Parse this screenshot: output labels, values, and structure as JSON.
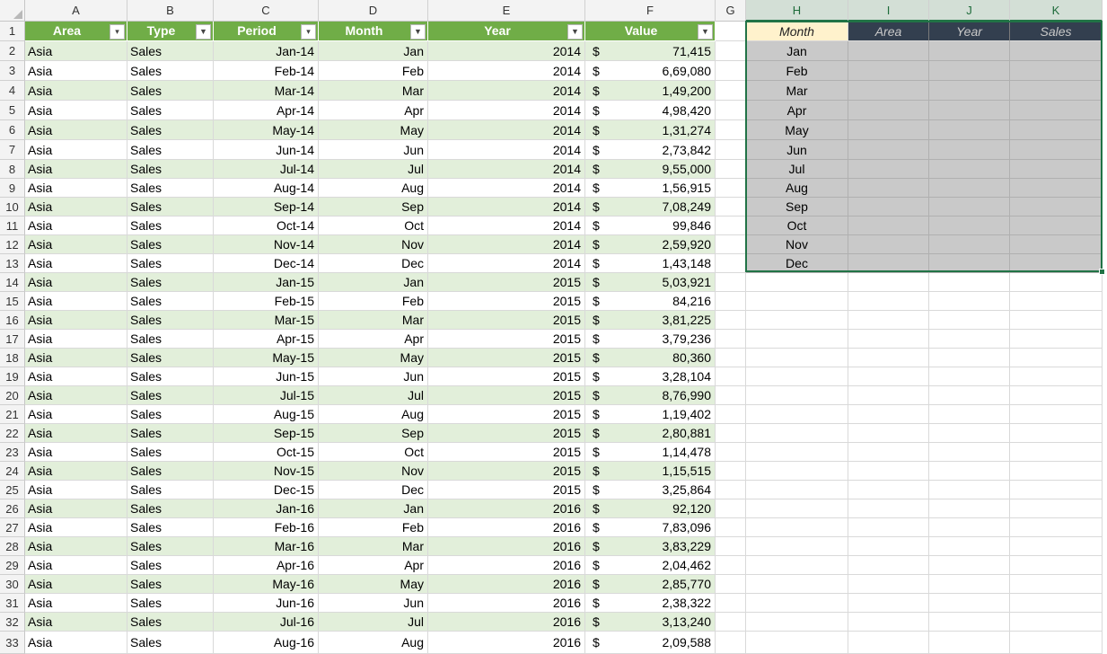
{
  "columns": [
    "A",
    "B",
    "C",
    "D",
    "E",
    "F",
    "G",
    "H",
    "I",
    "J",
    "K"
  ],
  "table_headers": {
    "A": "Area",
    "B": "Type",
    "C": "Period",
    "D": "Month",
    "E": "Year",
    "F": "Value"
  },
  "filter_icons": {
    "A": "sort-filter-icon",
    "B": "dropdown-icon",
    "C": "sort-filter-icon",
    "D": "dropdown-icon",
    "E": "dropdown-icon",
    "F": "dropdown-icon"
  },
  "summary_headers": {
    "H": "Month",
    "I": "Area",
    "J": "Year",
    "K": "Sales"
  },
  "currency_symbol": "$",
  "rows": [
    {
      "n": "2",
      "area": "Asia",
      "type": "Sales",
      "period": "Jan-14",
      "month": "Jan",
      "year": "2014",
      "value": "71,415"
    },
    {
      "n": "3",
      "area": "Asia",
      "type": "Sales",
      "period": "Feb-14",
      "month": "Feb",
      "year": "2014",
      "value": "6,69,080"
    },
    {
      "n": "4",
      "area": "Asia",
      "type": "Sales",
      "period": "Mar-14",
      "month": "Mar",
      "year": "2014",
      "value": "1,49,200"
    },
    {
      "n": "5",
      "area": "Asia",
      "type": "Sales",
      "period": "Apr-14",
      "month": "Apr",
      "year": "2014",
      "value": "4,98,420"
    },
    {
      "n": "6",
      "area": "Asia",
      "type": "Sales",
      "period": "May-14",
      "month": "May",
      "year": "2014",
      "value": "1,31,274"
    },
    {
      "n": "7",
      "area": "Asia",
      "type": "Sales",
      "period": "Jun-14",
      "month": "Jun",
      "year": "2014",
      "value": "2,73,842"
    },
    {
      "n": "8",
      "area": "Asia",
      "type": "Sales",
      "period": "Jul-14",
      "month": "Jul",
      "year": "2014",
      "value": "9,55,000"
    },
    {
      "n": "9",
      "area": "Asia",
      "type": "Sales",
      "period": "Aug-14",
      "month": "Aug",
      "year": "2014",
      "value": "1,56,915"
    },
    {
      "n": "10",
      "area": "Asia",
      "type": "Sales",
      "period": "Sep-14",
      "month": "Sep",
      "year": "2014",
      "value": "7,08,249"
    },
    {
      "n": "11",
      "area": "Asia",
      "type": "Sales",
      "period": "Oct-14",
      "month": "Oct",
      "year": "2014",
      "value": "99,846"
    },
    {
      "n": "12",
      "area": "Asia",
      "type": "Sales",
      "period": "Nov-14",
      "month": "Nov",
      "year": "2014",
      "value": "2,59,920"
    },
    {
      "n": "13",
      "area": "Asia",
      "type": "Sales",
      "period": "Dec-14",
      "month": "Dec",
      "year": "2014",
      "value": "1,43,148"
    },
    {
      "n": "14",
      "area": "Asia",
      "type": "Sales",
      "period": "Jan-15",
      "month": "Jan",
      "year": "2015",
      "value": "5,03,921"
    },
    {
      "n": "15",
      "area": "Asia",
      "type": "Sales",
      "period": "Feb-15",
      "month": "Feb",
      "year": "2015",
      "value": "84,216"
    },
    {
      "n": "16",
      "area": "Asia",
      "type": "Sales",
      "period": "Mar-15",
      "month": "Mar",
      "year": "2015",
      "value": "3,81,225"
    },
    {
      "n": "17",
      "area": "Asia",
      "type": "Sales",
      "period": "Apr-15",
      "month": "Apr",
      "year": "2015",
      "value": "3,79,236"
    },
    {
      "n": "18",
      "area": "Asia",
      "type": "Sales",
      "period": "May-15",
      "month": "May",
      "year": "2015",
      "value": "80,360"
    },
    {
      "n": "19",
      "area": "Asia",
      "type": "Sales",
      "period": "Jun-15",
      "month": "Jun",
      "year": "2015",
      "value": "3,28,104"
    },
    {
      "n": "20",
      "area": "Asia",
      "type": "Sales",
      "period": "Jul-15",
      "month": "Jul",
      "year": "2015",
      "value": "8,76,990"
    },
    {
      "n": "21",
      "area": "Asia",
      "type": "Sales",
      "period": "Aug-15",
      "month": "Aug",
      "year": "2015",
      "value": "1,19,402"
    },
    {
      "n": "22",
      "area": "Asia",
      "type": "Sales",
      "period": "Sep-15",
      "month": "Sep",
      "year": "2015",
      "value": "2,80,881"
    },
    {
      "n": "23",
      "area": "Asia",
      "type": "Sales",
      "period": "Oct-15",
      "month": "Oct",
      "year": "2015",
      "value": "1,14,478"
    },
    {
      "n": "24",
      "area": "Asia",
      "type": "Sales",
      "period": "Nov-15",
      "month": "Nov",
      "year": "2015",
      "value": "1,15,515"
    },
    {
      "n": "25",
      "area": "Asia",
      "type": "Sales",
      "period": "Dec-15",
      "month": "Dec",
      "year": "2015",
      "value": "3,25,864"
    },
    {
      "n": "26",
      "area": "Asia",
      "type": "Sales",
      "period": "Jan-16",
      "month": "Jan",
      "year": "2016",
      "value": "92,120"
    },
    {
      "n": "27",
      "area": "Asia",
      "type": "Sales",
      "period": "Feb-16",
      "month": "Feb",
      "year": "2016",
      "value": "7,83,096"
    },
    {
      "n": "28",
      "area": "Asia",
      "type": "Sales",
      "period": "Mar-16",
      "month": "Mar",
      "year": "2016",
      "value": "3,83,229"
    },
    {
      "n": "29",
      "area": "Asia",
      "type": "Sales",
      "period": "Apr-16",
      "month": "Apr",
      "year": "2016",
      "value": "2,04,462"
    },
    {
      "n": "30",
      "area": "Asia",
      "type": "Sales",
      "period": "May-16",
      "month": "May",
      "year": "2016",
      "value": "2,85,770"
    },
    {
      "n": "31",
      "area": "Asia",
      "type": "Sales",
      "period": "Jun-16",
      "month": "Jun",
      "year": "2016",
      "value": "2,38,322"
    },
    {
      "n": "32",
      "area": "Asia",
      "type": "Sales",
      "period": "Jul-16",
      "month": "Jul",
      "year": "2016",
      "value": "3,13,240"
    },
    {
      "n": "33",
      "area": "Asia",
      "type": "Sales",
      "period": "Aug-16",
      "month": "Aug",
      "year": "2016",
      "value": "2,09,588"
    }
  ],
  "summary_months": [
    "Jan",
    "Feb",
    "Mar",
    "Apr",
    "May",
    "Jun",
    "Jul",
    "Aug",
    "Sep",
    "Oct",
    "Nov",
    "Dec"
  ],
  "colors": {
    "table_header": "#70ad47",
    "band": "#e2efda",
    "summary_header_dark": "#333f4f",
    "summary_header_month": "#fff2cc",
    "summary_fill": "#c9c9c9",
    "selection": "#217346"
  }
}
